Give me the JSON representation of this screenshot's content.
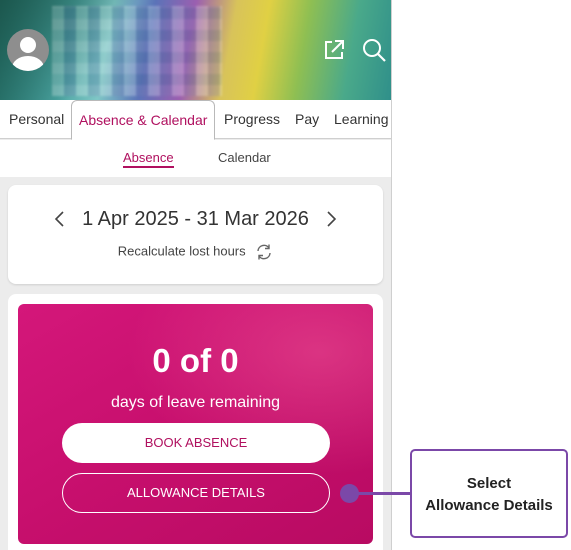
{
  "header": {
    "avatar_icon": "user-avatar-icon",
    "external_link_icon": "external-link-icon",
    "search_icon": "search-icon"
  },
  "tabs": [
    {
      "label": "Personal"
    },
    {
      "label": "Absence & Calendar",
      "active": true
    },
    {
      "label": "Progress"
    },
    {
      "label": "Pay"
    },
    {
      "label": "Learning"
    }
  ],
  "subtabs": [
    {
      "label": "Absence",
      "active": true
    },
    {
      "label": "Calendar"
    }
  ],
  "period": {
    "range": "1 Apr 2025 - 31 Mar 2026",
    "recalculate_label": "Recalculate lost hours"
  },
  "leave": {
    "count": "0 of 0",
    "label": "days of leave remaining",
    "book_button": "BOOK ABSENCE",
    "allowance_button": "ALLOWANCE DETAILS"
  },
  "callout": {
    "line1": "Select",
    "line2": "Allowance Details"
  },
  "colors": {
    "accent": "#b0105f",
    "card": "#c70f6d",
    "callout": "#7b48a8"
  }
}
